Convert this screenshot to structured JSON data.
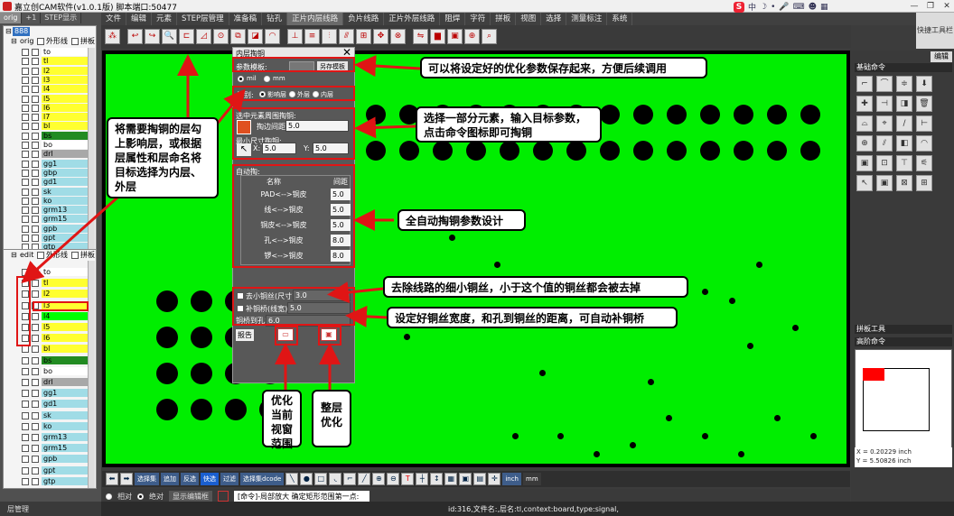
{
  "window": {
    "title": "嘉立创CAM软件(v1.0.1版) 脚本端口:50477"
  },
  "ime": {
    "logo": "S"
  },
  "menu": [
    "文件",
    "编辑",
    "元素",
    "STEP层管理",
    "准备稿",
    "钻孔",
    "正片内层线路",
    "负片线路",
    "正片外层线路",
    "阻焊",
    "字符",
    "拼板",
    "视图",
    "选择",
    "测量标注",
    "系统"
  ],
  "menu_active": "正片内层线路",
  "quick_toolbar": "快捷工具栏",
  "left_tabs": [
    "orig",
    "+1",
    "STEP显示"
  ],
  "tree1": {
    "root": "888",
    "step": "orig",
    "opt1": "外形线",
    "opt2": "拼板",
    "layers": [
      {
        "name": "to",
        "color": "#ffffff"
      },
      {
        "name": "tl",
        "color": "#ffff30"
      },
      {
        "name": "l2",
        "color": "#ffff30"
      },
      {
        "name": "l3",
        "color": "#ffff30"
      },
      {
        "name": "l4",
        "color": "#ffff30"
      },
      {
        "name": "l5",
        "color": "#ffff30"
      },
      {
        "name": "l6",
        "color": "#ffff30"
      },
      {
        "name": "l7",
        "color": "#ffff30"
      },
      {
        "name": "bl",
        "color": "#ffff30"
      },
      {
        "name": "bs",
        "color": "#228b22"
      },
      {
        "name": "bo",
        "color": "#ffffff"
      },
      {
        "name": "drl",
        "color": "#a8a8a8"
      },
      {
        "name": "gg1",
        "color": "#a0dce6"
      },
      {
        "name": "gbp",
        "color": "#a0dce6"
      },
      {
        "name": "gd1",
        "color": "#a0dce6"
      },
      {
        "name": "sk",
        "color": "#a0dce6"
      },
      {
        "name": "ko",
        "color": "#a0dce6"
      },
      {
        "name": "grm13",
        "color": "#a0dce6"
      },
      {
        "name": "grm15",
        "color": "#a0dce6"
      },
      {
        "name": "gpb",
        "color": "#a0dce6"
      },
      {
        "name": "gpt",
        "color": "#a0dce6"
      },
      {
        "name": "gtp",
        "color": "#a0dce6"
      }
    ]
  },
  "tree2": {
    "step": "edit",
    "opt1": "外形线",
    "opt2": "拼板",
    "layers": [
      {
        "name": "to",
        "color": "#ffffff"
      },
      {
        "name": "tl",
        "color": "#ffff30"
      },
      {
        "name": "l2",
        "color": "#ffff30"
      },
      {
        "name": "l3",
        "color": "#ffff30"
      },
      {
        "name": "l4",
        "color": "#00ff00"
      },
      {
        "name": "l5",
        "color": "#ffff30"
      },
      {
        "name": "l6",
        "color": "#ffff30"
      },
      {
        "name": "bl",
        "color": "#ffff30"
      },
      {
        "name": "bs",
        "color": "#228b22"
      },
      {
        "name": "bo",
        "color": "#ffffff"
      },
      {
        "name": "drl",
        "color": "#a8a8a8"
      },
      {
        "name": "gg1",
        "color": "#a0dce6"
      },
      {
        "name": "gd1",
        "color": "#a0dce6"
      },
      {
        "name": "sk",
        "color": "#a0dce6"
      },
      {
        "name": "ko",
        "color": "#a0dce6"
      },
      {
        "name": "grm13",
        "color": "#a0dce6"
      },
      {
        "name": "grm15",
        "color": "#a0dce6"
      },
      {
        "name": "gpb",
        "color": "#a0dce6"
      },
      {
        "name": "gpt",
        "color": "#a0dce6"
      },
      {
        "name": "gtp",
        "color": "#a0dce6"
      }
    ]
  },
  "layer_manager": "层管理",
  "dialog": {
    "title": "内层掏铜",
    "param_template_label": "参数模板:",
    "save_as_template": "另存模板",
    "unit_mil": "mil",
    "unit_mm": "mm",
    "layer_label": "层别:",
    "layer_opt1": "影响层",
    "layer_opt2": "外层",
    "layer_opt3": "内层",
    "selected_title": "选中元素周围掏铜:",
    "target_gap_label": "掏边间距:",
    "target_gap_value": "5.0",
    "min_size_label": "最小尺寸掏铜:",
    "x_label": "X:",
    "x_value": "5.0",
    "y_label": "Y:",
    "y_value": "5.0",
    "auto_title": "自动掏:",
    "col_name": "名称",
    "col_gap": "间距",
    "auto_rows": [
      {
        "name": "PAD<-->铜皮",
        "value": "5.0"
      },
      {
        "name": "线<-->铜皮",
        "value": "5.0"
      },
      {
        "name": "铜皮<-->铜皮",
        "value": "5.0"
      },
      {
        "name": "孔<-->铜皮",
        "value": "8.0"
      },
      {
        "name": "锣<-->铜皮",
        "value": "8.0"
      }
    ],
    "remove_thin_label": "去小铜丝(尺寸)",
    "remove_thin_value": "3.0",
    "bridge_label": "补铜桥(线宽)",
    "bridge_value": "5.0",
    "bridge_hole_label": "铜桥到孔>",
    "bridge_hole_value": "6.0",
    "report": "报告"
  },
  "callouts": {
    "layer_select": "将需要掏铜的层勾上影响层，或根据层属性和层命名将目标选择为内层、外层",
    "save_template": "可以将设定好的优化参数保存起来，方便后续调用",
    "select_elements": "选择一部分元素，输入目标参数，点击命令图标即可掏铜",
    "auto_params": "全自动掏铜参数设计",
    "remove_thin": "去除线路的细小铜丝，小于这个值的铜丝都会被去掉",
    "bridge": "设定好铜丝宽度，和孔到铜丝的距离，可自动补铜桥",
    "optimize_view": "优化当前视窗范围",
    "optimize_layer": "整层优化"
  },
  "right_panel": {
    "edit": "编辑",
    "basic": "基础命令",
    "panel_tools": "拼板工具",
    "advanced": "高阶命令"
  },
  "coords": {
    "x": "X = 0.20229 inch",
    "y": "Y = 5.50826 inch"
  },
  "bottom_buttons": [
    "选择集",
    "追加",
    "反选",
    "快选",
    "过滤",
    "选择集dcode"
  ],
  "units_bottom": [
    "inch",
    "mm"
  ],
  "cmd": {
    "rel": "相对",
    "abs": "绝对",
    "show_edit": "显示编辑框",
    "prompt": "[命令]-局部放大 确定矩形范围第一点:"
  },
  "status_text": "id:316,文件名:,层名:tl,context:board,type:signal,"
}
